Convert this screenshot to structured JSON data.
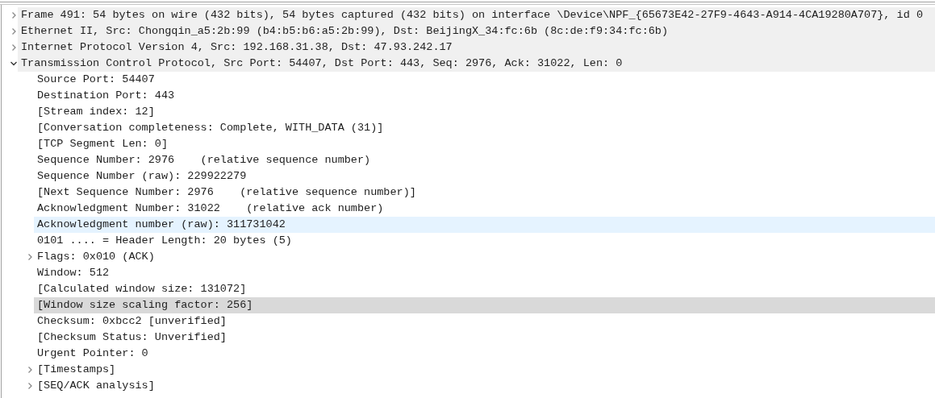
{
  "tree": [
    {
      "label": "Frame 491: 54 bytes on wire (432 bits), 54 bytes captured (432 bits) on interface \\Device\\NPF_{65673E42-27F9-4643-A914-4CA19280A707}, id 0",
      "expanded": false,
      "selected": false,
      "hovered": false
    },
    {
      "label": "Ethernet II, Src: Chongqin_a5:2b:99 (b4:b5:b6:a5:2b:99), Dst: BeijingX_34:fc:6b (8c:de:f9:34:fc:6b)",
      "expanded": false,
      "selected": false,
      "hovered": false
    },
    {
      "label": "Internet Protocol Version 4, Src: 192.168.31.38, Dst: 47.93.242.17",
      "expanded": false,
      "selected": false,
      "hovered": false
    },
    {
      "label": "Transmission Control Protocol, Src Port: 54407, Dst Port: 443, Seq: 2976, Ack: 31022, Len: 0",
      "expanded": true,
      "selected": false,
      "hovered": false,
      "children": [
        {
          "label": "Source Port: 54407",
          "selected": false,
          "hovered": false
        },
        {
          "label": "Destination Port: 443",
          "selected": false,
          "hovered": false
        },
        {
          "label": "[Stream index: 12]",
          "selected": false,
          "hovered": false
        },
        {
          "label": "[Conversation completeness: Complete, WITH_DATA (31)]",
          "selected": false,
          "hovered": false
        },
        {
          "label": "[TCP Segment Len: 0]",
          "selected": false,
          "hovered": false
        },
        {
          "label": "Sequence Number: 2976    (relative sequence number)",
          "selected": false,
          "hovered": false
        },
        {
          "label": "Sequence Number (raw): 229922279",
          "selected": false,
          "hovered": false
        },
        {
          "label": "[Next Sequence Number: 2976    (relative sequence number)]",
          "selected": false,
          "hovered": false
        },
        {
          "label": "Acknowledgment Number: 31022    (relative ack number)",
          "selected": false,
          "hovered": false
        },
        {
          "label": "Acknowledgment number (raw): 311731042",
          "selected": false,
          "hovered": true
        },
        {
          "label": "0101 .... = Header Length: 20 bytes (5)",
          "selected": false,
          "hovered": false
        },
        {
          "label": "Flags: 0x010 (ACK)",
          "expanded": false,
          "selected": false,
          "hovered": false
        },
        {
          "label": "Window: 512",
          "selected": false,
          "hovered": false
        },
        {
          "label": "[Calculated window size: 131072]",
          "selected": false,
          "hovered": false
        },
        {
          "label": "[Window size scaling factor: 256]",
          "selected": true,
          "hovered": false
        },
        {
          "label": "Checksum: 0xbcc2 [unverified]",
          "selected": false,
          "hovered": false
        },
        {
          "label": "[Checksum Status: Unverified]",
          "selected": false,
          "hovered": false
        },
        {
          "label": "Urgent Pointer: 0",
          "selected": false,
          "hovered": false
        },
        {
          "label": "[Timestamps]",
          "expanded": false,
          "selected": false,
          "hovered": false
        },
        {
          "label": "[SEQ/ACK analysis]",
          "expanded": false,
          "selected": false,
          "hovered": false
        }
      ]
    }
  ]
}
